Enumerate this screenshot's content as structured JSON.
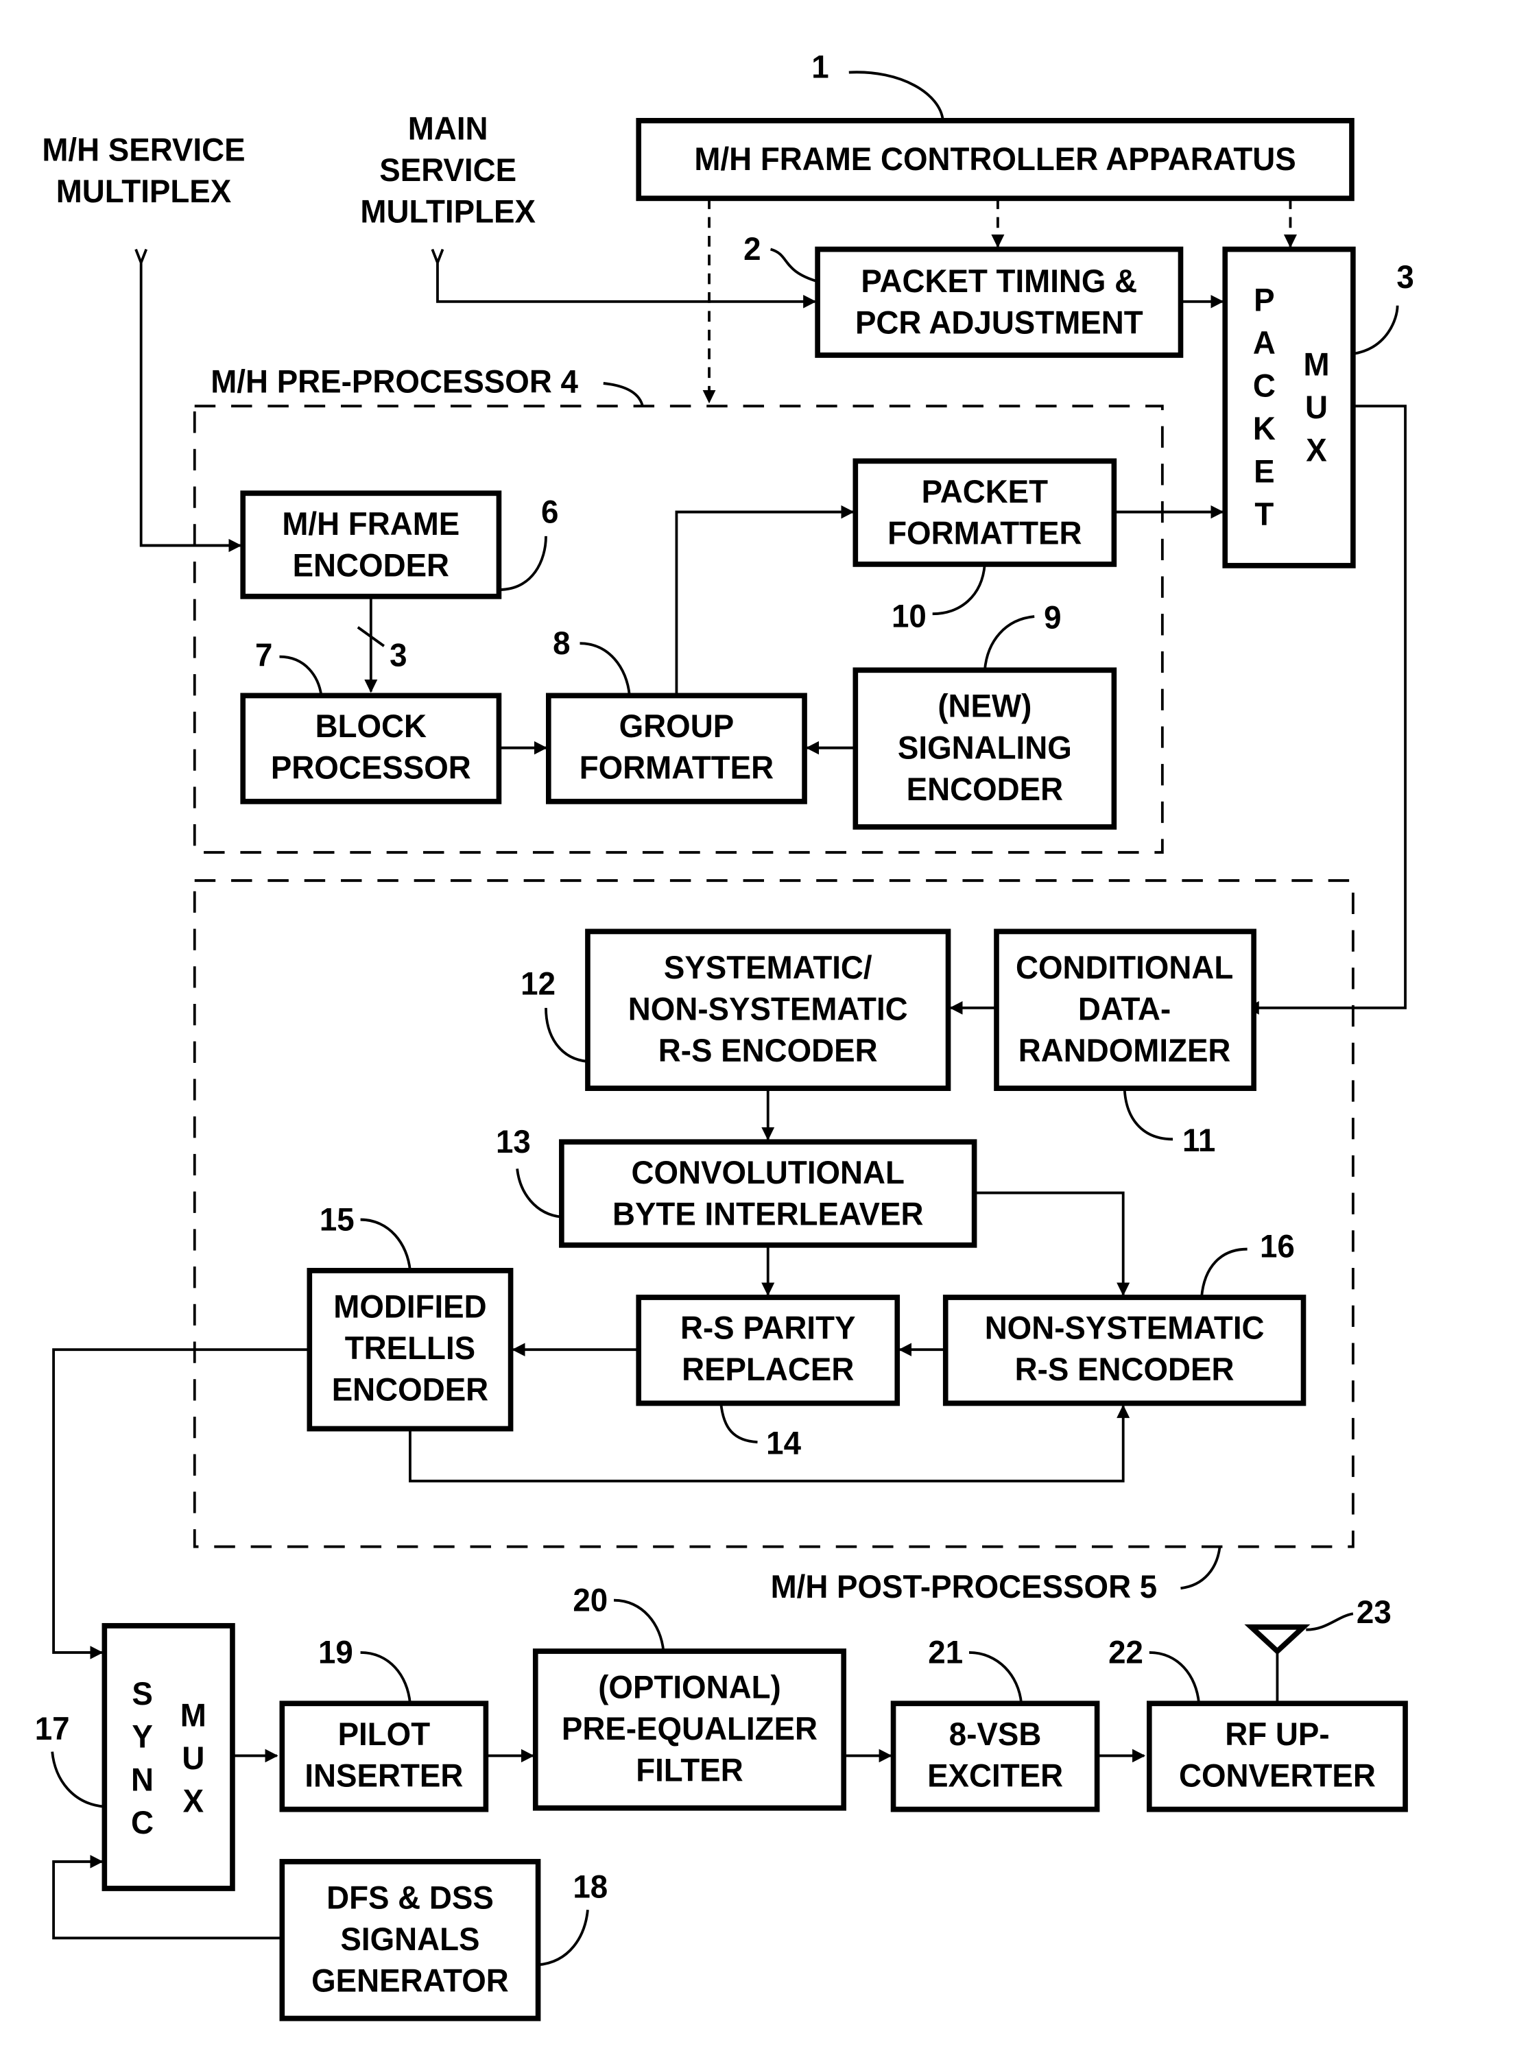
{
  "inputs": {
    "mh_service": [
      "M/H SERVICE",
      "MULTIPLEX"
    ],
    "main_service": [
      "MAIN",
      "SERVICE",
      "MULTIPLEX"
    ]
  },
  "regions": {
    "pre_processor": "M/H PRE-PROCESSOR 4",
    "post_processor": "M/H POST-PROCESSOR 5"
  },
  "blocks": {
    "controller": {
      "ref": "1",
      "lines": [
        "M/H FRAME CONTROLLER APPARATUS"
      ]
    },
    "packet_timing": {
      "ref": "2",
      "lines": [
        "PACKET TIMING &",
        "PCR ADJUSTMENT"
      ]
    },
    "packet_mux": {
      "ref": "3",
      "col1": [
        "P",
        "A",
        "C",
        "K",
        "E",
        "T"
      ],
      "col2": [
        "M",
        "U",
        "X"
      ]
    },
    "frame_encoder": {
      "ref": "6",
      "lines": [
        "M/H FRAME",
        "ENCODER"
      ]
    },
    "block_processor": {
      "ref": "7",
      "lines": [
        "BLOCK",
        "PROCESSOR"
      ]
    },
    "group_formatter": {
      "ref": "8",
      "lines": [
        "GROUP",
        "FORMATTER"
      ]
    },
    "signaling_encoder": {
      "ref": "9",
      "lines": [
        "(NEW)",
        "SIGNALING",
        "ENCODER"
      ]
    },
    "packet_formatter": {
      "ref": "10",
      "lines": [
        "PACKET",
        "FORMATTER"
      ]
    },
    "randomizer": {
      "ref": "11",
      "lines": [
        "CONDITIONAL",
        "DATA-",
        "RANDOMIZER"
      ]
    },
    "rs_encoder": {
      "ref": "12",
      "lines": [
        "SYSTEMATIC/",
        "NON-SYSTEMATIC",
        "R-S ENCODER"
      ]
    },
    "interleaver": {
      "ref": "13",
      "lines": [
        "CONVOLUTIONAL",
        "BYTE INTERLEAVER"
      ]
    },
    "parity_replacer": {
      "ref": "14",
      "lines": [
        "R-S PARITY",
        "REPLACER"
      ]
    },
    "trellis_encoder": {
      "ref": "15",
      "lines": [
        "MODIFIED",
        "TRELLIS",
        "ENCODER"
      ]
    },
    "ns_rs_encoder": {
      "ref": "16",
      "lines": [
        "NON-SYSTEMATIC",
        "R-S ENCODER"
      ]
    },
    "sync_mux": {
      "ref": "17",
      "col1": [
        "S",
        "Y",
        "N",
        "C"
      ],
      "col2": [
        "M",
        "U",
        "X"
      ]
    },
    "dfs_generator": {
      "ref": "18",
      "lines": [
        "DFS & DSS",
        "SIGNALS",
        "GENERATOR"
      ]
    },
    "pilot_inserter": {
      "ref": "19",
      "lines": [
        "PILOT",
        "INSERTER"
      ]
    },
    "pre_equalizer": {
      "ref": "20",
      "lines": [
        "(OPTIONAL)",
        "PRE-EQUALIZER",
        "FILTER"
      ]
    },
    "exciter": {
      "ref": "21",
      "lines": [
        "8-VSB",
        "EXCITER"
      ]
    },
    "upconverter": {
      "ref": "22",
      "lines": [
        "RF UP-",
        "CONVERTER"
      ]
    },
    "antenna": {
      "ref": "23"
    }
  },
  "bus_width": "3"
}
